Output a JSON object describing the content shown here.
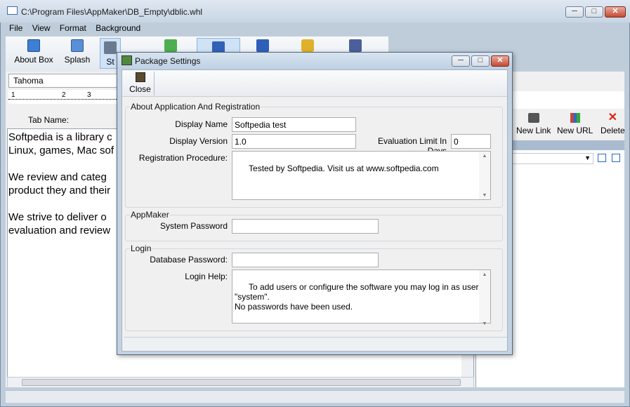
{
  "window": {
    "title": "C:\\Program Files\\AppMaker\\DB_Empty\\dblic.whl",
    "minimize": "─",
    "maximize": "□",
    "close": "✕"
  },
  "menu": [
    "File",
    "View",
    "Format",
    "Background"
  ],
  "toolbar": {
    "about_box": "About Box",
    "splash": "Splash",
    "start": "St"
  },
  "font_selector": {
    "value": "Tahoma"
  },
  "ruler": {
    "ticks": [
      "1",
      "2",
      "3"
    ]
  },
  "tab_name_label": "Tab Name:",
  "editor": {
    "paragraphs": [
      [
        "Softpedia is a library c",
        "Linux, games, Mac sof"
      ],
      [
        "We review and categ",
        "product they and their"
      ],
      [
        "We strive to deliver o",
        "evaluation and review"
      ]
    ]
  },
  "right_panel": {
    "new_link": "New Link",
    "new_url": "New URL",
    "delete": "Delete"
  },
  "dialog": {
    "title": "Package Settings",
    "close_label": "Close",
    "about_group": "About Application And Registration",
    "display_name_label": "Display Name",
    "display_name_value": "Softpedia test",
    "display_version_label": "Display Version",
    "display_version_value": "1.0",
    "eval_limit_label": "Evaluation Limit In Days",
    "eval_limit_value": "0",
    "reg_proc_label": "Registration Procedure:",
    "reg_proc_value": "Tested by Softpedia. Visit us at www.softpedia.com",
    "appmaker_group": "AppMaker",
    "system_password_label": "System Password",
    "system_password_value": "",
    "login_group": "Login",
    "db_password_label": "Database Password:",
    "db_password_value": "",
    "login_help_label": "Login Help:",
    "login_help_value": "To add users or configure the software you may log in as user \"system\".\nNo passwords have been used."
  },
  "colors": {
    "accent": "#2a67c9",
    "title_bg": "#c7d5e4",
    "dialog_frame": "#c2d2e2"
  }
}
